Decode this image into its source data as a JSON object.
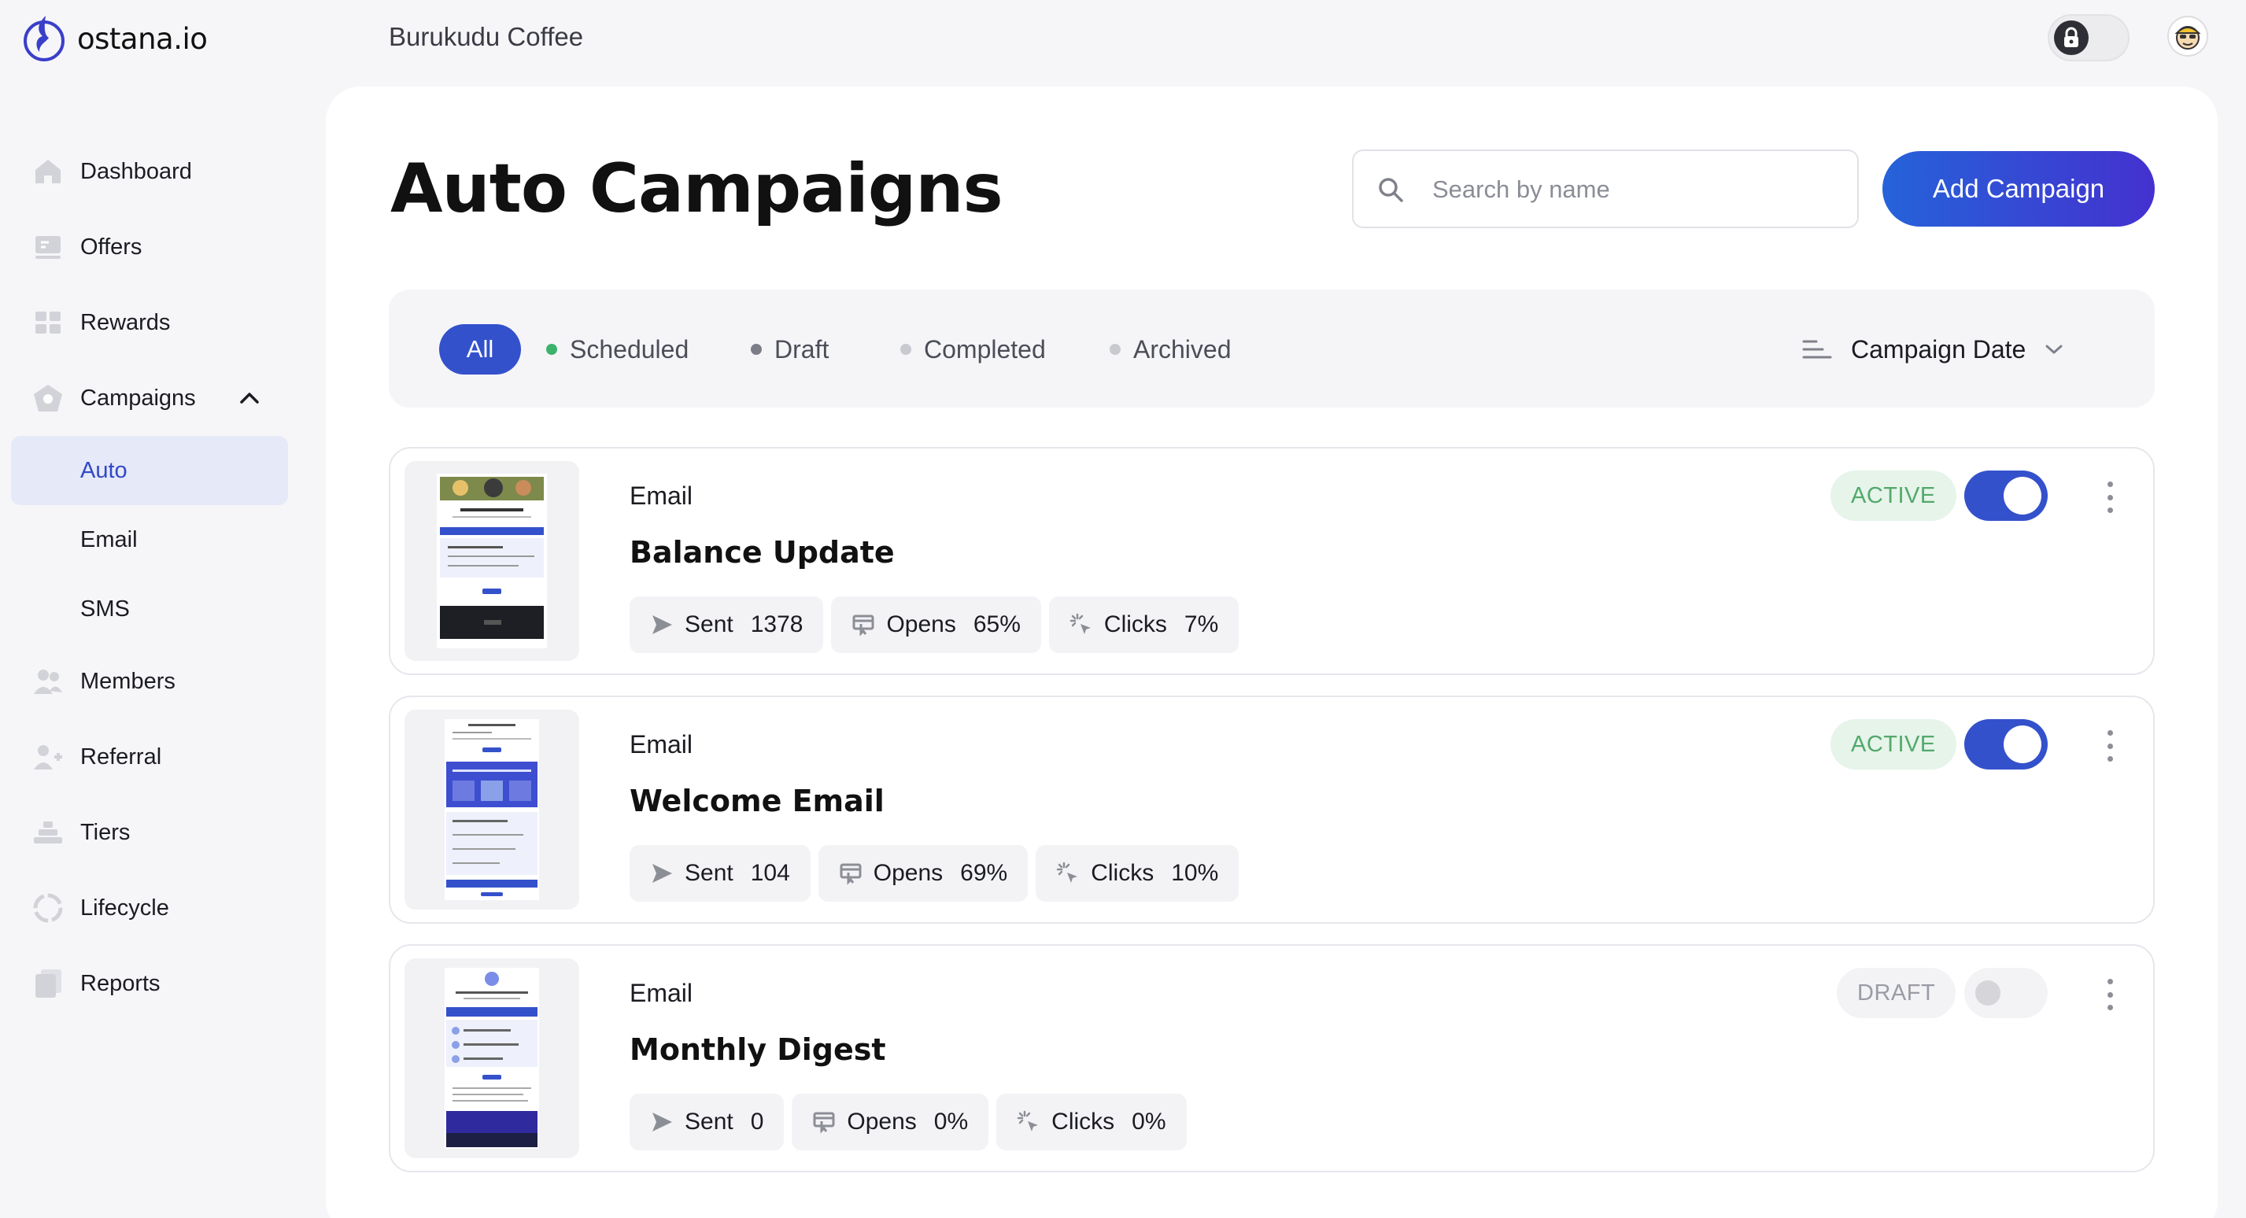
{
  "brand": {
    "name": "ostana.io"
  },
  "header": {
    "organization": "Burukudu Coffee"
  },
  "sidebar": {
    "items": [
      {
        "label": "Dashboard"
      },
      {
        "label": "Offers"
      },
      {
        "label": "Rewards"
      },
      {
        "label": "Campaigns",
        "expanded": true
      },
      {
        "label": "Members"
      },
      {
        "label": "Referral"
      },
      {
        "label": "Tiers"
      },
      {
        "label": "Lifecycle"
      },
      {
        "label": "Reports"
      }
    ],
    "campaign_subitems": [
      {
        "label": "Auto",
        "active": true
      },
      {
        "label": "Email"
      },
      {
        "label": "SMS"
      }
    ]
  },
  "page": {
    "title": "Auto Campaigns",
    "search_placeholder": "Search by name",
    "add_button": "Add Campaign"
  },
  "filters": {
    "tabs": [
      {
        "label": "All",
        "selected": true
      },
      {
        "label": "Scheduled",
        "dot_color": "#3bb36b"
      },
      {
        "label": "Draft",
        "dot_color": "#7b7d87"
      },
      {
        "label": "Completed",
        "dot_color": "#c9cad0"
      },
      {
        "label": "Archived",
        "dot_color": "#c9cad0"
      }
    ],
    "sort_label": "Campaign Date"
  },
  "campaigns": [
    {
      "channel": "Email",
      "name": "Balance Update",
      "status": "ACTIVE",
      "enabled": true,
      "stats": {
        "sent_label": "Sent",
        "sent": "1378",
        "opens_label": "Opens",
        "opens": "65%",
        "clicks_label": "Clicks",
        "clicks": "7%"
      }
    },
    {
      "channel": "Email",
      "name": "Welcome Email",
      "status": "ACTIVE",
      "enabled": true,
      "stats": {
        "sent_label": "Sent",
        "sent": "104",
        "opens_label": "Opens",
        "opens": "69%",
        "clicks_label": "Clicks",
        "clicks": "10%"
      }
    },
    {
      "channel": "Email",
      "name": "Monthly Digest",
      "status": "DRAFT",
      "enabled": false,
      "stats": {
        "sent_label": "Sent",
        "sent": "0",
        "opens_label": "Opens",
        "opens": "0%",
        "clicks_label": "Clicks",
        "clicks": "0%"
      }
    }
  ],
  "colors": {
    "accent": "#3451cc",
    "active_badge_bg": "#e6f4ea",
    "active_badge_text": "#52a96b",
    "sidebar_active_bg": "#e6e9f8"
  }
}
